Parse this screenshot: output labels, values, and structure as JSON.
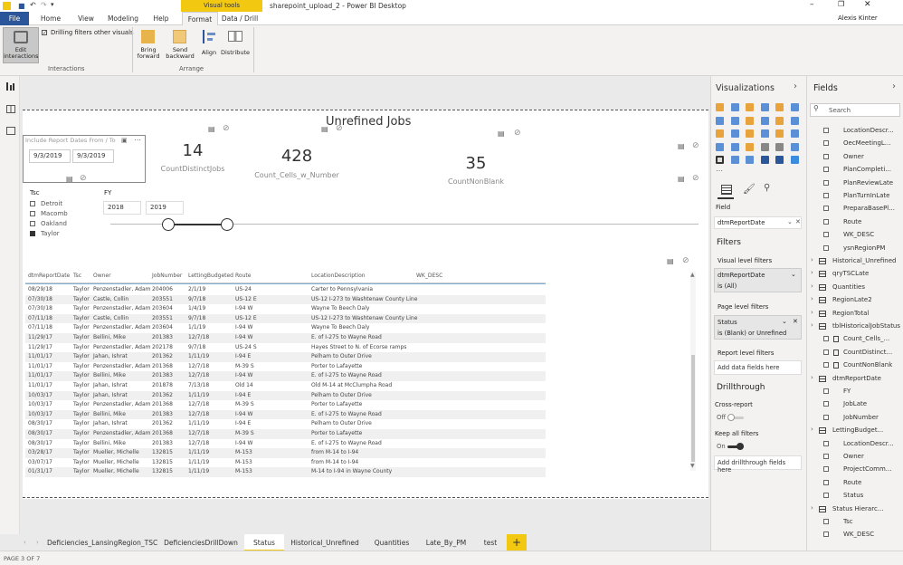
{
  "window": {
    "title": "sharepoint_upload_2 - Power BI Desktop",
    "contextual_tab_group": "Visual tools",
    "user": "Alexis Kinter"
  },
  "ribbon_tabs": [
    {
      "label": "File"
    },
    {
      "label": "Home"
    },
    {
      "label": "View"
    },
    {
      "label": "Modeling"
    },
    {
      "label": "Help"
    },
    {
      "label": "Format"
    },
    {
      "label": "Data / Drill"
    }
  ],
  "ribbon": {
    "edit_interactions": "Edit\ninteractions",
    "drilling_filters": "Drilling filters other visuals",
    "interactions_group": "Interactions",
    "bring_forward": "Bring\nforward",
    "send_backward": "Send\nbackward",
    "align": "Align",
    "distribute": "Distribute",
    "arrange_group": "Arrange"
  },
  "report": {
    "title": "Unrefined Jobs",
    "date_slicer": {
      "title": "Include Report Dates From / To",
      "from": "9/3/2019",
      "to": "9/3/2019"
    },
    "cards": [
      {
        "value": "14",
        "label": "CountDistinctJobs"
      },
      {
        "value": "428",
        "label": "Count_Cells_w_Number"
      },
      {
        "value": "35",
        "label": "CountNonBlank"
      }
    ],
    "tsc_slicer": {
      "title": "Tsc",
      "items": [
        {
          "label": "Detroit",
          "checked": false
        },
        {
          "label": "Macomb",
          "checked": false
        },
        {
          "label": "Oakland",
          "checked": false
        },
        {
          "label": "Taylor",
          "checked": true
        }
      ]
    },
    "fy_slicer": {
      "title": "FY",
      "from": "2018",
      "to": "2019"
    },
    "table": {
      "columns": [
        "dtmReportDate",
        "Tsc",
        "Owner",
        "JobNumber",
        "LettingBudgeted",
        "Route",
        "LocationDescription",
        "WK_DESC"
      ],
      "rows": [
        [
          "08/29/18",
          "Taylor",
          "Penzenstadler, Adam",
          "204006",
          "2/1/19",
          "US-24",
          "Carter to Pennsylvania",
          ""
        ],
        [
          "07/30/18",
          "Taylor",
          "Castle, Collin",
          "203551",
          "9/7/18",
          "US-12 E",
          "US-12 I-273 to Washtenaw County Line",
          ""
        ],
        [
          "07/30/18",
          "Taylor",
          "Penzenstadler, Adam",
          "203604",
          "1/4/19",
          "I-94 W",
          "Wayne To Beech Daly",
          ""
        ],
        [
          "07/11/18",
          "Taylor",
          "Castle, Collin",
          "203551",
          "9/7/18",
          "US-12 E",
          "US-12 I-273 to Washtenaw County Line",
          ""
        ],
        [
          "07/11/18",
          "Taylor",
          "Penzenstadler, Adam",
          "203604",
          "1/1/19",
          "I-94 W",
          "Wayne To Beech Daly",
          ""
        ],
        [
          "11/29/17",
          "Taylor",
          "Bellini, Mike",
          "201383",
          "12/7/18",
          "I-94 W",
          "E. of I-275 to Wayne Road",
          ""
        ],
        [
          "11/29/17",
          "Taylor",
          "Penzenstadler, Adam",
          "202178",
          "9/7/18",
          "US-24 S",
          "Hayes Street to N. of Ecorse ramps",
          ""
        ],
        [
          "11/01/17",
          "Taylor",
          "Jahan, Ishrat",
          "201362",
          "1/11/19",
          "I-94 E",
          "Pelham to Outer Drive",
          ""
        ],
        [
          "11/01/17",
          "Taylor",
          "Penzenstadler, Adam",
          "201368",
          "12/7/18",
          "M-39 S",
          "Porter to Lafayette",
          ""
        ],
        [
          "11/01/17",
          "Taylor",
          "Bellini, Mike",
          "201383",
          "12/7/18",
          "I-94 W",
          "E. of I-275 to Wayne Road",
          ""
        ],
        [
          "11/01/17",
          "Taylor",
          "Jahan, Ishrat",
          "201878",
          "7/13/18",
          "Old 14",
          "Old M-14 at McClumpha Road",
          ""
        ],
        [
          "10/03/17",
          "Taylor",
          "Jahan, Ishrat",
          "201362",
          "1/11/19",
          "I-94 E",
          "Pelham to Outer Drive",
          ""
        ],
        [
          "10/03/17",
          "Taylor",
          "Penzenstadler, Adam",
          "201368",
          "12/7/18",
          "M-39 S",
          "Porter to Lafayette",
          ""
        ],
        [
          "10/03/17",
          "Taylor",
          "Bellini, Mike",
          "201383",
          "12/7/18",
          "I-94 W",
          "E. of I-275 to Wayne Road",
          ""
        ],
        [
          "08/30/17",
          "Taylor",
          "Jahan, Ishrat",
          "201362",
          "1/11/19",
          "I-94 E",
          "Pelham to Outer Drive",
          ""
        ],
        [
          "08/30/17",
          "Taylor",
          "Penzenstadler, Adam",
          "201368",
          "12/7/18",
          "M-39 S",
          "Porter to Lafayette",
          ""
        ],
        [
          "08/30/17",
          "Taylor",
          "Bellini, Mike",
          "201383",
          "12/7/18",
          "I-94 W",
          "E. of I-275 to Wayne Road",
          ""
        ],
        [
          "03/28/17",
          "Taylor",
          "Mueller, Michelle",
          "132815",
          "1/11/19",
          "M-153",
          "from M-14 to I-94",
          ""
        ],
        [
          "03/07/17",
          "Taylor",
          "Mueller, Michelle",
          "132815",
          "1/11/19",
          "M-153",
          "from M-14 to I-94",
          ""
        ],
        [
          "01/31/17",
          "Taylor",
          "Mueller, Michelle",
          "132815",
          "1/11/19",
          "M-153",
          "M-14 to I-94 in Wayne County",
          ""
        ]
      ]
    }
  },
  "viz_pane": {
    "title": "Visualizations",
    "field_label": "Field",
    "field_value": "dtmReportDate",
    "filters_title": "Filters",
    "visual_level": "Visual level filters",
    "vl_filter_name": "dtmReportDate",
    "vl_filter_val": "is (All)",
    "page_level": "Page level filters",
    "pl_filter_name": "Status",
    "pl_filter_val": "is (Blank) or Unrefined",
    "report_level": "Report level filters",
    "add_data_fields": "Add data fields here",
    "drillthrough_title": "Drillthrough",
    "cross_report": "Cross-report",
    "cross_report_state": "Off",
    "keep_all_filters": "Keep all filters",
    "keep_all_state": "On",
    "add_drillthrough": "Add drillthrough fields here"
  },
  "fields_pane": {
    "title": "Fields",
    "search_placeholder": "Search",
    "items": [
      {
        "label": "LocationDescr...",
        "kind": "field"
      },
      {
        "label": "OecMeetingL...",
        "kind": "field"
      },
      {
        "label": "Owner",
        "kind": "field"
      },
      {
        "label": "PlanCompleti...",
        "kind": "field"
      },
      {
        "label": "PlanReviewLate",
        "kind": "field"
      },
      {
        "label": "PlanTurnInLate",
        "kind": "field"
      },
      {
        "label": "PreparaBasePl...",
        "kind": "field"
      },
      {
        "label": "Route",
        "kind": "field"
      },
      {
        "label": "WK_DESC",
        "kind": "field"
      },
      {
        "label": "ysnRegionPM",
        "kind": "field"
      },
      {
        "label": "Historical_Unrefined",
        "kind": "table"
      },
      {
        "label": "qryTSCLate",
        "kind": "table"
      },
      {
        "label": "Quantities",
        "kind": "table"
      },
      {
        "label": "RegionLate2",
        "kind": "table"
      },
      {
        "label": "RegionTotal",
        "kind": "table"
      },
      {
        "label": "tblHistoricalJobStatus",
        "kind": "table"
      },
      {
        "label": "Count_Cells_...",
        "kind": "measure"
      },
      {
        "label": "CountDistinct...",
        "kind": "measure"
      },
      {
        "label": "CountNonBlank",
        "kind": "measure"
      },
      {
        "label": "dtmReportDate",
        "kind": "table"
      },
      {
        "label": "FY",
        "kind": "field"
      },
      {
        "label": "JobLate",
        "kind": "field"
      },
      {
        "label": "JobNumber",
        "kind": "field"
      },
      {
        "label": "LettingBudget...",
        "kind": "table"
      },
      {
        "label": "LocationDescr...",
        "kind": "field"
      },
      {
        "label": "Owner",
        "kind": "field"
      },
      {
        "label": "ProjectComm...",
        "kind": "field"
      },
      {
        "label": "Route",
        "kind": "field"
      },
      {
        "label": "Status",
        "kind": "field"
      },
      {
        "label": "Status Hierarc...",
        "kind": "table"
      },
      {
        "label": "Tsc",
        "kind": "field"
      },
      {
        "label": "WK_DESC",
        "kind": "field"
      }
    ]
  },
  "page_tabs": [
    "Deficiencies_LansingRegion_TSC",
    "DeficienciesDrillDown",
    "Status",
    "Historical_Unrefined",
    "Quantities",
    "Late_By_PM",
    "test"
  ],
  "active_page_tab": "Status",
  "status_bar": "PAGE 3 OF 7",
  "colors": {
    "accent": "#f2c811",
    "file_tab": "#2b579a",
    "slider": "#333333"
  }
}
